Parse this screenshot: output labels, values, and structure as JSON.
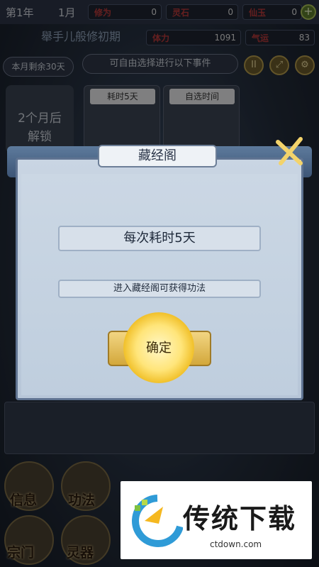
{
  "hud": {
    "year": "第1年",
    "month": "1月",
    "stat1": {
      "label": "修为",
      "value": "0"
    },
    "stat2": {
      "label": "灵石",
      "value": "0"
    },
    "stat3": {
      "label": "仙玉",
      "value": "0"
    },
    "title_text": "舉手儿般修初期",
    "hp": {
      "label": "体力",
      "value": "1091"
    },
    "qi": {
      "label": "气运",
      "value": "83"
    },
    "remain": "本月剩余30天",
    "event_prompt": "可自由选择进行以下事件"
  },
  "cards": {
    "locked_line1": "2个月后",
    "locked_line2": "解锁",
    "card1_tag": "耗时5天",
    "card2_tag": "自选时间"
  },
  "dialog": {
    "title": "藏经阁",
    "time_cost": "每次耗时5天",
    "description": "进入藏经阁可获得功法",
    "confirm": "确定"
  },
  "bottom_nav": {
    "item1": "信息",
    "item2": "功法",
    "item3": "宗门",
    "item4": "灵器"
  },
  "watermark": {
    "name": "传统下载",
    "url": "ctdown.com"
  },
  "colors": {
    "dialog_bg": "#c4d1e0",
    "confirm_gold": "#f1c12b",
    "stat_label_red": "#b83a3a"
  }
}
